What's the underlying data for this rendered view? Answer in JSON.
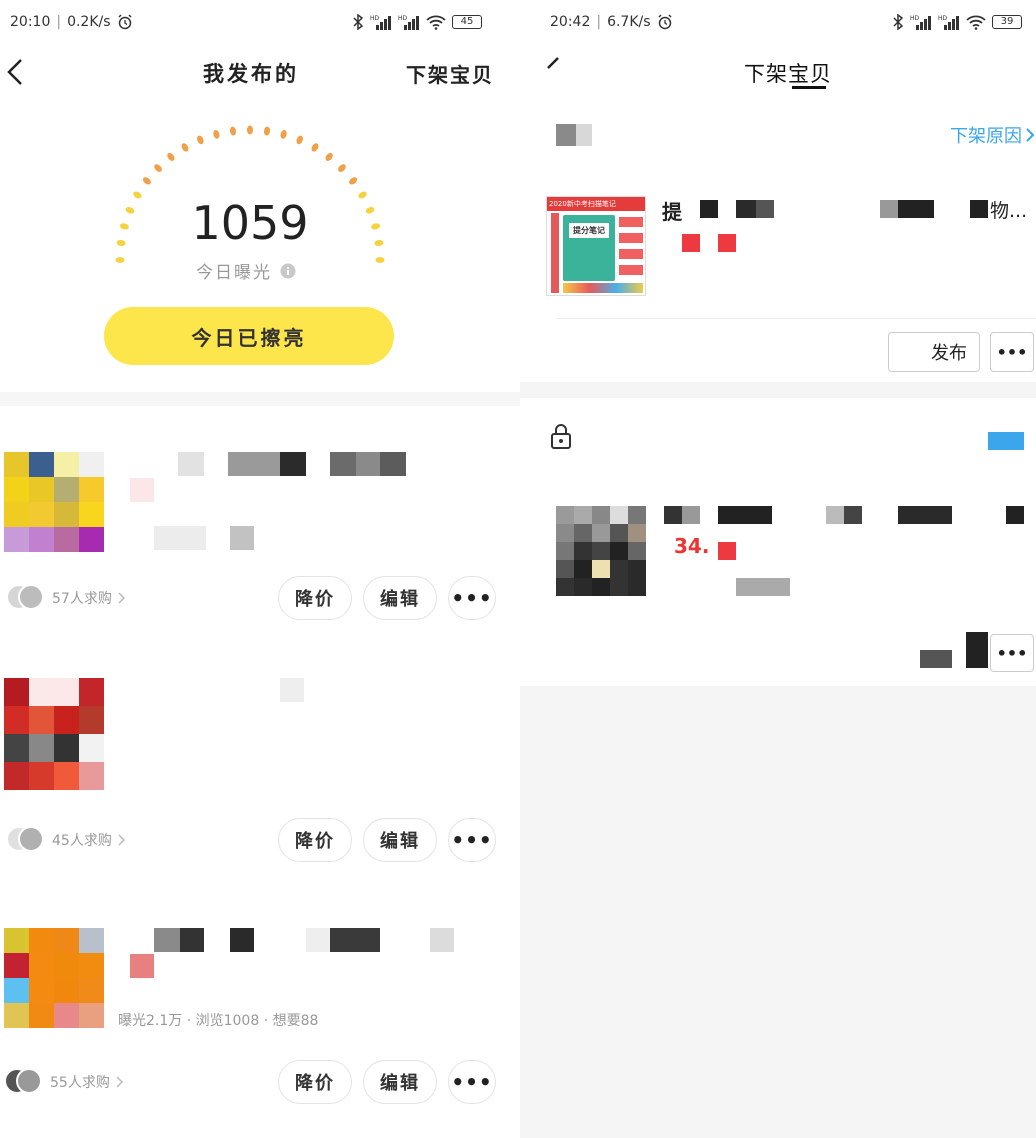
{
  "left": {
    "status": {
      "time": "20:10",
      "speed": "0.2K/s",
      "battery": "45",
      "alarm_icon": "alarm-clock-icon"
    },
    "nav": {
      "back_icon": "chevron-left-icon",
      "title": "我发布的",
      "right_action": "下架宝贝"
    },
    "exposure": {
      "value": "1059",
      "label": "今日曝光",
      "info_icon": "info-icon",
      "button": "今日已擦亮",
      "accent": "#fde54c"
    },
    "items": [
      {
        "buyers": "57人求购",
        "actions": [
          "降价",
          "编辑"
        ]
      },
      {
        "buyers": "45人求购",
        "actions": [
          "降价",
          "编辑"
        ]
      },
      {
        "stats": "曝光2.1万 · 浏览1008 · 想要88",
        "buyers": "55人求购",
        "actions": [
          "降价",
          "编辑"
        ]
      }
    ],
    "more_label": "•••"
  },
  "right": {
    "status": {
      "time": "20:42",
      "speed": "6.7K/s",
      "battery": "39"
    },
    "nav": {
      "title": "下架宝贝"
    },
    "card1": {
      "reason_link": "下架原因",
      "title_start": "提",
      "title_end": "物...",
      "thumb_title": "2020新中考扫描笔记",
      "thumb_badge": "提分笔记",
      "relist_button": "发布",
      "more_label": "•••"
    },
    "card2": {
      "price": "34.",
      "more_label": "•••"
    },
    "accent_blue": "#3ba6ec"
  }
}
